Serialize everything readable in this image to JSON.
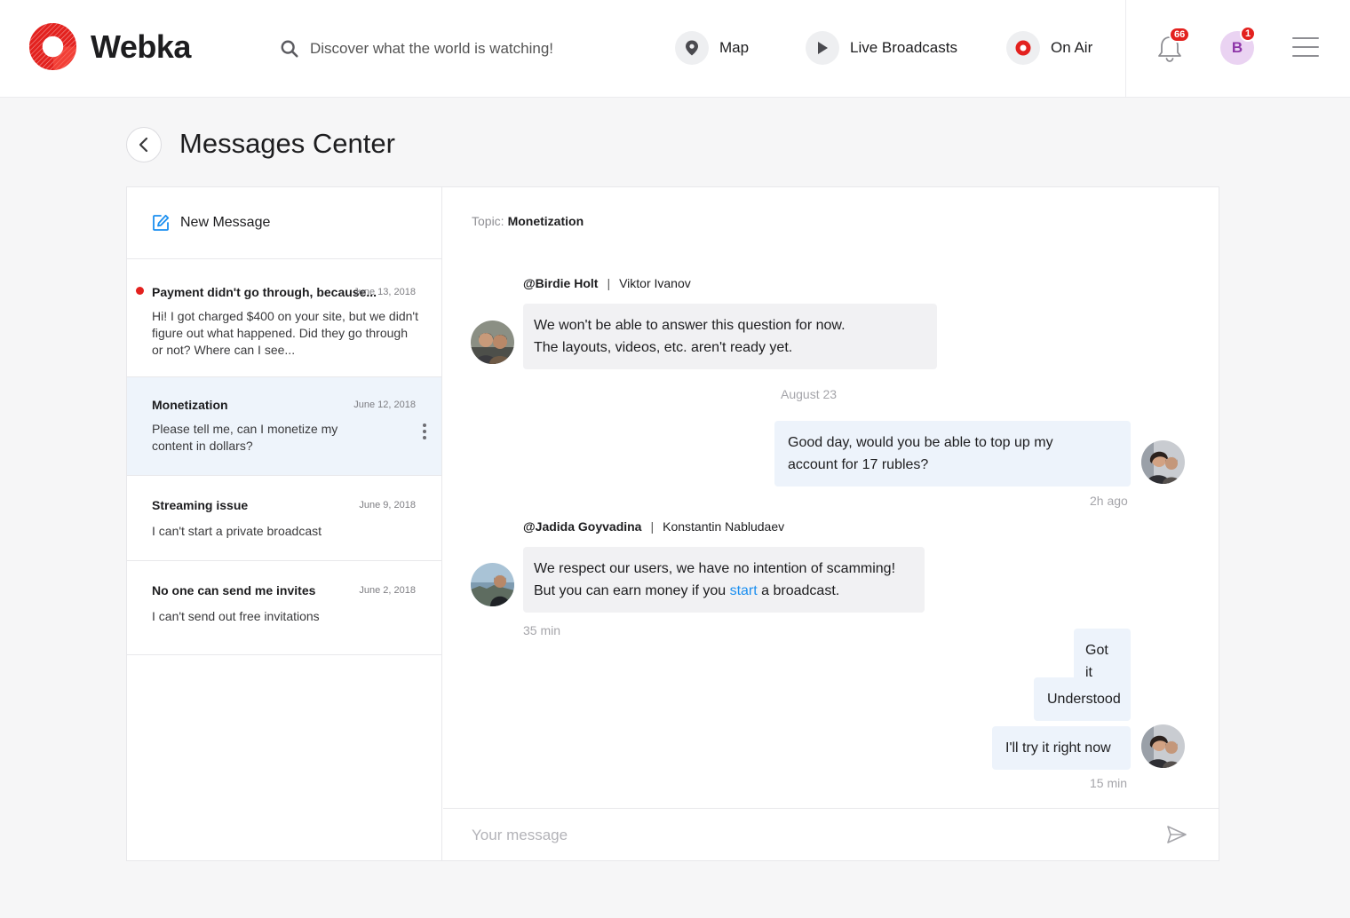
{
  "header": {
    "brand": "Webka",
    "search_placeholder": "Discover what the world is watching!",
    "nav": [
      {
        "label": "Map",
        "icon": "map-pin-icon"
      },
      {
        "label": "Live Broadcasts",
        "icon": "play-icon"
      },
      {
        "label": "On Air",
        "icon": "record-icon"
      }
    ],
    "notifications_count": "66",
    "user_initial": "B",
    "user_badge": "1"
  },
  "page": {
    "title": "Messages Center"
  },
  "sidebar": {
    "new_message_label": "New Message",
    "threads": [
      {
        "title": "Payment didn't go through, because...",
        "date": "June 13, 2018",
        "preview": "Hi! I got charged $400 on your site, but we didn't figure out what happened. Did they go through or not? Where can I see...",
        "unread": true
      },
      {
        "title": "Monetization",
        "date": "June 12, 2018",
        "preview": "Please tell me, can I monetize my content in dollars?",
        "active": true
      },
      {
        "title": "Streaming issue",
        "date": "June 9, 2018",
        "preview": "I can't start a private broadcast"
      },
      {
        "title": "No one can send me invites",
        "date": "June 2, 2018",
        "preview": "I can't send out free invitations"
      }
    ]
  },
  "chat": {
    "topic_label": "Topic:",
    "topic": "Monetization",
    "messages": [
      {
        "handle": "@Birdie Holt",
        "name": "Viktor Ivanov",
        "line1": "We won't be able to answer this question for now.",
        "line2": "The layouts, videos, etc. aren't ready yet."
      },
      {
        "date_divider": "August 23"
      },
      {
        "line1": "Good day, would you be able to top up my",
        "line2": "account for 17 rubles?",
        "time": "2h ago"
      },
      {
        "handle": "@Jadida Goyvadina",
        "name": "Konstantin Nabludaev",
        "line1": "We respect our users, we have no intention of scamming!",
        "line2_before": "But you can earn money if you ",
        "line2_link": "start",
        "line2_after": " a broadcast.",
        "time": "35 min"
      },
      {
        "text": "Got it"
      },
      {
        "text": "Understood"
      },
      {
        "text": "I'll try it right now",
        "time": "15 min"
      }
    ],
    "composer_placeholder": "Your message"
  },
  "colors": {
    "accent_red": "#e3211e",
    "link_blue": "#1b8ff0",
    "active_thread_bg": "#eef4fb",
    "outgoing_bubble_bg": "#edf3fb",
    "incoming_bubble_bg": "#f1f1f3"
  }
}
